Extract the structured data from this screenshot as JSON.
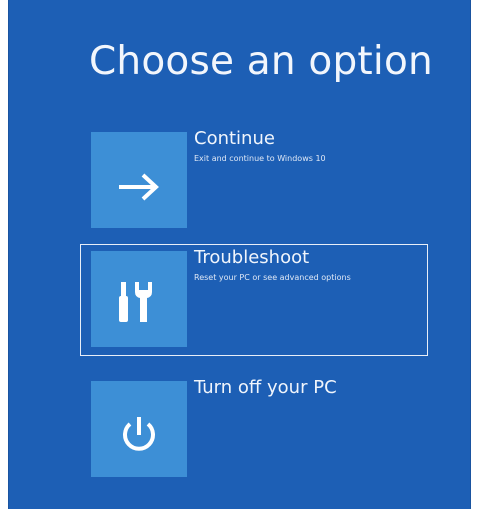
{
  "screen": {
    "title": "Choose an option",
    "background_color": "#1d5fb5",
    "tile_color": "#3d8fd6"
  },
  "options": [
    {
      "label": "Continue",
      "description": "Exit and continue to Windows 10",
      "icon": "arrow-right-icon",
      "selected": false
    },
    {
      "label": "Troubleshoot",
      "description": "Reset your PC or see advanced options",
      "icon": "tools-icon",
      "selected": true
    },
    {
      "label": "Turn off your PC",
      "description": "",
      "icon": "power-icon",
      "selected": false
    }
  ]
}
